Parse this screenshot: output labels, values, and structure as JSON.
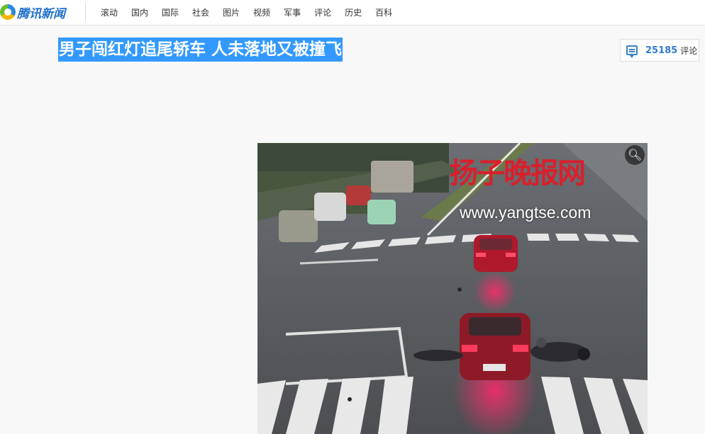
{
  "brand": {
    "name": "腾讯新闻"
  },
  "nav": {
    "items": [
      "滚动",
      "国内",
      "国际",
      "社会",
      "图片",
      "视频",
      "军事",
      "评论",
      "历史",
      "百科"
    ]
  },
  "article": {
    "title": "男子闯红灯追尾轿车 人未落地又被撞飞"
  },
  "comments": {
    "count": "25185",
    "label": "评论"
  },
  "photo": {
    "watermark_logo": "扬子晚报网",
    "watermark_url": "www.yangtse.com",
    "zoom_icon": "magnifier-icon"
  },
  "colors": {
    "title_highlight": "#3399ff",
    "brand_blue": "#1f6fc9",
    "comment_blue": "#2e7bcf",
    "watermark_red": "#d8202c"
  }
}
